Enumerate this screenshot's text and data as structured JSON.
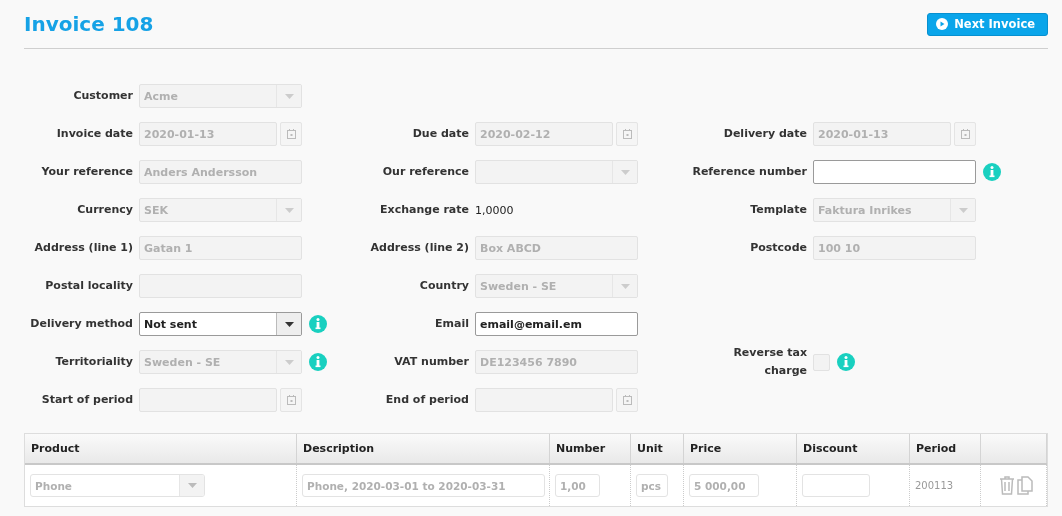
{
  "title": "Invoice 108",
  "next_button": {
    "label": "Next Invoice"
  },
  "form_rows": [
    {
      "cells": [
        {
          "label": "Customer",
          "kind": "select",
          "value": "Acme",
          "disabled": true
        },
        {
          "kind": "blank"
        },
        {
          "kind": "blank"
        }
      ]
    },
    {
      "cells": [
        {
          "label": "Invoice date",
          "kind": "date",
          "value": "2020-01-13",
          "disabled": true
        },
        {
          "label": "Due date",
          "kind": "date",
          "value": "2020-02-12",
          "disabled": true
        },
        {
          "label": "Delivery date",
          "kind": "date",
          "value": "2020-01-13",
          "disabled": true
        }
      ]
    },
    {
      "cells": [
        {
          "label": "Your reference",
          "kind": "text",
          "value": "Anders Andersson",
          "disabled": true
        },
        {
          "label": "Our reference",
          "kind": "select",
          "disabled": true
        },
        {
          "label": "Reference number",
          "kind": "text",
          "disabled": false,
          "info": true
        }
      ]
    },
    {
      "cells": [
        {
          "label": "Currency",
          "kind": "select",
          "value": "SEK",
          "disabled": true
        },
        {
          "label": "Exchange rate",
          "kind": "static",
          "value": "1,0000"
        },
        {
          "label": "Template",
          "kind": "select",
          "value": "Faktura Inrikes",
          "disabled": true
        }
      ]
    },
    {
      "cells": [
        {
          "label": "Address (line 1)",
          "kind": "text",
          "value": "Gatan 1",
          "disabled": true
        },
        {
          "label": "Address (line 2)",
          "kind": "text",
          "value": "Box ABCD",
          "disabled": true
        },
        {
          "label": "Postcode",
          "kind": "text",
          "value": "100 10",
          "disabled": true
        }
      ]
    },
    {
      "cells": [
        {
          "label": "Postal locality",
          "kind": "text",
          "disabled": true
        },
        {
          "label": "Country",
          "kind": "select",
          "value": "Sweden - SE",
          "disabled": true
        },
        {
          "kind": "blank"
        }
      ]
    },
    {
      "cells": [
        {
          "label": "Delivery method",
          "kind": "select",
          "value": "Not sent",
          "disabled": false,
          "info": true
        },
        {
          "label": "Email",
          "kind": "text",
          "value": "email@email.em",
          "disabled": false
        },
        {
          "kind": "blank"
        }
      ]
    },
    {
      "cells": [
        {
          "label": "Territoriality",
          "kind": "select",
          "value": "Sweden - SE",
          "disabled": true,
          "info": true
        },
        {
          "label": "VAT number",
          "kind": "text",
          "value": "DE123456 7890",
          "disabled": true
        },
        {
          "label": "Reverse tax charge",
          "kind": "checkbox",
          "checked": false,
          "info": true
        }
      ]
    },
    {
      "cells": [
        {
          "label": "Start of period",
          "kind": "date",
          "disabled": true
        },
        {
          "label": "End of period",
          "kind": "date",
          "disabled": true
        },
        {
          "kind": "blank"
        }
      ]
    }
  ],
  "table": {
    "columns": [
      "Product",
      "Description",
      "Number",
      "Unit",
      "Price",
      "Discount",
      "Period"
    ],
    "rows": [
      {
        "cells": [
          {
            "kind": "select",
            "value": "Phone"
          },
          {
            "kind": "textarea",
            "value": "Phone, 2020-03-01 to 2020-03-31"
          },
          {
            "kind": "input",
            "value": "1,00"
          },
          {
            "kind": "input",
            "value": "pcs"
          },
          {
            "kind": "input",
            "value": "5 000,00"
          },
          {
            "kind": "input"
          },
          {
            "kind": "text",
            "value": "200113"
          },
          {
            "kind": "actions"
          }
        ]
      }
    ]
  }
}
